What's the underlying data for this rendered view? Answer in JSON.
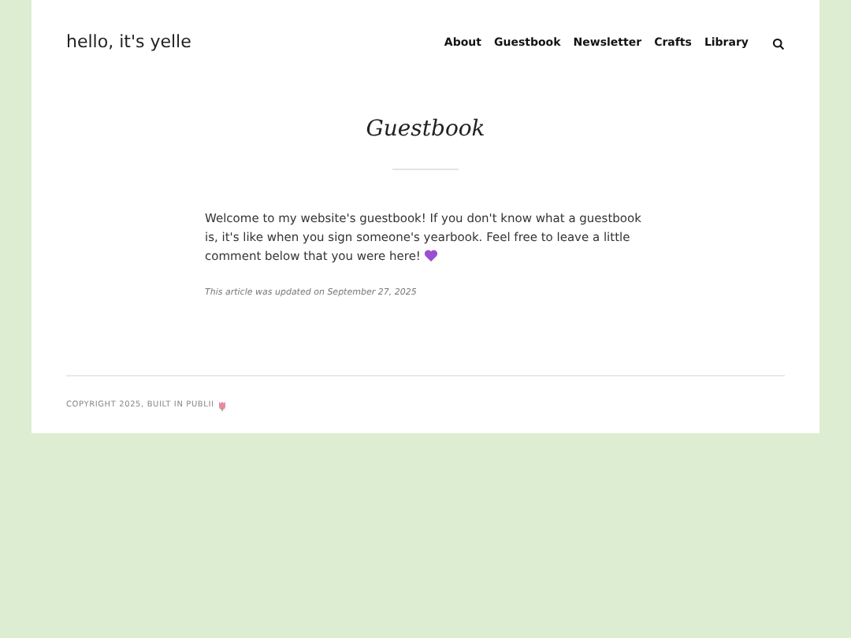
{
  "site_title": "hello, it's yelle",
  "nav": [
    {
      "label": "About",
      "selected": false
    },
    {
      "label": "Guestbook",
      "selected": false
    },
    {
      "label": "Newsletter",
      "selected": false
    },
    {
      "label": "Crafts",
      "selected": false
    },
    {
      "label": "Library",
      "selected": false
    }
  ],
  "page_title": "Guestbook",
  "body": "Welcome to my website's guestbook! If you don't know what a guestbook is, it's like when you sign someone's yearbook. Feel free to leave a little comment below that you were here!",
  "updated": "This article was updated on September 27, 2025",
  "footer": "COPYRIGHT 2025, BUILT IN PUBLII"
}
